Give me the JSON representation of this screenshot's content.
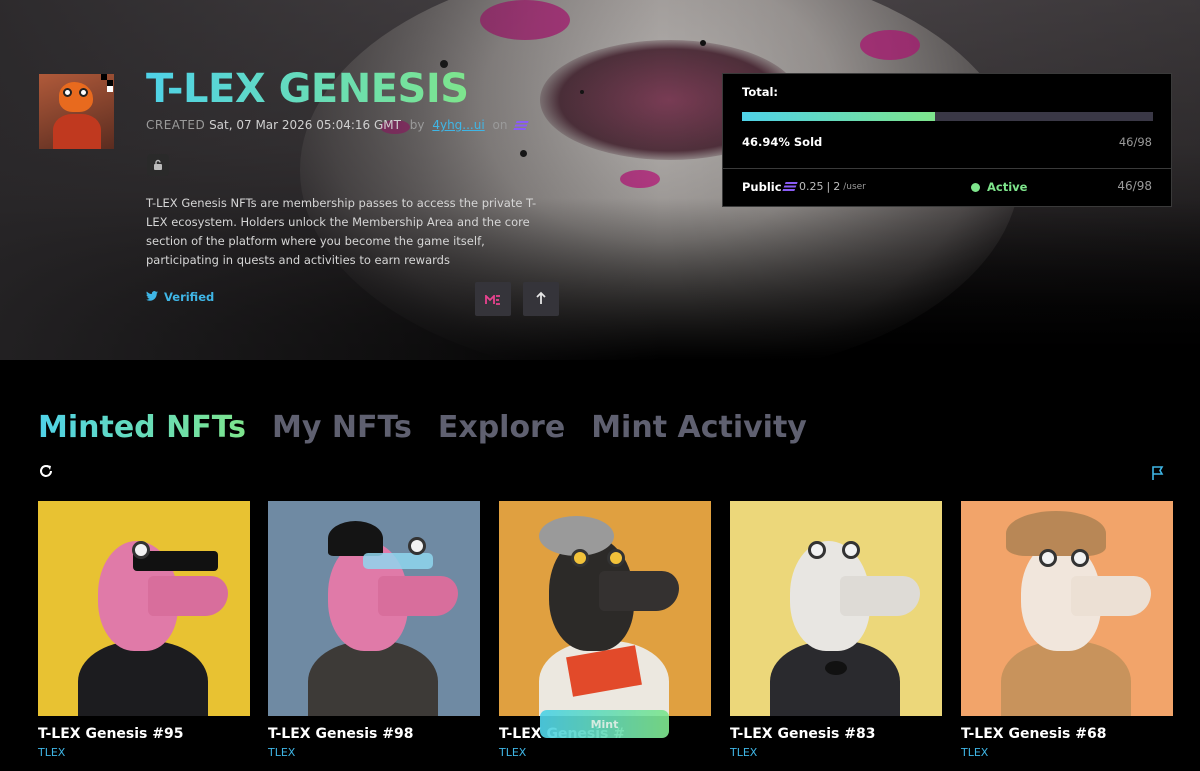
{
  "collection": {
    "title": "T-LEX GENESIS",
    "created_label": "CREATED",
    "created_date": "Sat, 07 Mar 2026 05:04:16 GMT",
    "by_label": "by",
    "author": "4yhg...ui",
    "on_label": "on",
    "chain_icon": "solana-icon",
    "description": "T-LEX Genesis NFTs are membership passes to access the private T-LEX ecosystem. Holders unlock the Membership Area and the core section of the platform where you become the game itself, participating in quests and activities to earn rewards",
    "verified_label": "Verified"
  },
  "mint_panel": {
    "total_label": "Total:",
    "sold_fraction": 0.4694,
    "sold_label": "46.94% Sold",
    "count": "46/98",
    "phase": {
      "name": "Public",
      "price": "0.25",
      "separator": "|",
      "limit": "2",
      "limit_unit": "/user",
      "status": "Active",
      "count": "46/98"
    }
  },
  "tabs": [
    {
      "label": "Minted NFTs",
      "active": true
    },
    {
      "label": "My NFTs",
      "active": false
    },
    {
      "label": "Explore",
      "active": false
    },
    {
      "label": "Mint Activity",
      "active": false
    }
  ],
  "cards": [
    {
      "name": "T-LEX Genesis #95",
      "collection": "TLEX",
      "bg": "#e8c232"
    },
    {
      "name": "T-LEX Genesis #98",
      "collection": "TLEX",
      "bg": "#6f8aa3"
    },
    {
      "name": "T-LEX Genesis #",
      "collection": "TLEX",
      "bg": "#e0a040"
    },
    {
      "name": "T-LEX Genesis #83",
      "collection": "TLEX",
      "bg": "#ecd77a"
    },
    {
      "name": "T-LEX Genesis #68",
      "collection": "TLEX",
      "bg": "#f2a46a"
    }
  ],
  "mint_button_label": "Mint",
  "colors": {
    "accent_start": "#4fd2e8",
    "accent_end": "#7ee58c",
    "link": "#3fb6e6"
  }
}
